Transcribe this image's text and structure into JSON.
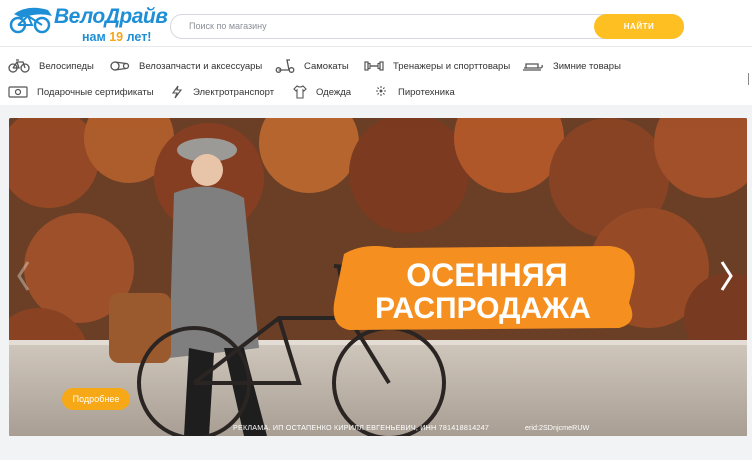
{
  "logo": {
    "brand": "ВелоДрайв",
    "tagline_prefix": "нам",
    "tagline_years": "19",
    "tagline_suffix": "лет!"
  },
  "search": {
    "placeholder": "Поиск по магазину",
    "button_label": "НАЙТИ"
  },
  "nav": {
    "row1": [
      {
        "label": "Велосипеды",
        "icon": "bicycle-icon"
      },
      {
        "label": "Велозапчасти и аксессуары",
        "icon": "bike-chain-icon"
      },
      {
        "label": "Самокаты",
        "icon": "scooter-icon"
      },
      {
        "label": "Тренажеры и спорттовары",
        "icon": "dumbbell-icon"
      },
      {
        "label": "Зимние товары",
        "icon": "sled-icon"
      }
    ],
    "row2": [
      {
        "label": "Подарочные сертификаты",
        "icon": "gift-card-icon"
      },
      {
        "label": "Электротранспорт",
        "icon": "lightning-icon"
      },
      {
        "label": "Одежда",
        "icon": "tshirt-icon"
      },
      {
        "label": "Пиротехника",
        "icon": "firework-icon"
      }
    ]
  },
  "banner": {
    "headline_line1": "ОСЕННЯЯ",
    "headline_line2": "РАСПРОДАЖА",
    "more_label": "Подробнее",
    "ad_notice": "РЕКЛАМА. ИП ОСТАПЕНКО КИРИЛЛ ЕВГЕНЬЕВИЧ, ИНН 781418814247",
    "erid": "erid:2SDnjcmeRUW"
  },
  "colors": {
    "brand_blue": "#1e8fd6",
    "accent_yellow": "#fdbf22",
    "sale_orange": "#f58f1f"
  }
}
